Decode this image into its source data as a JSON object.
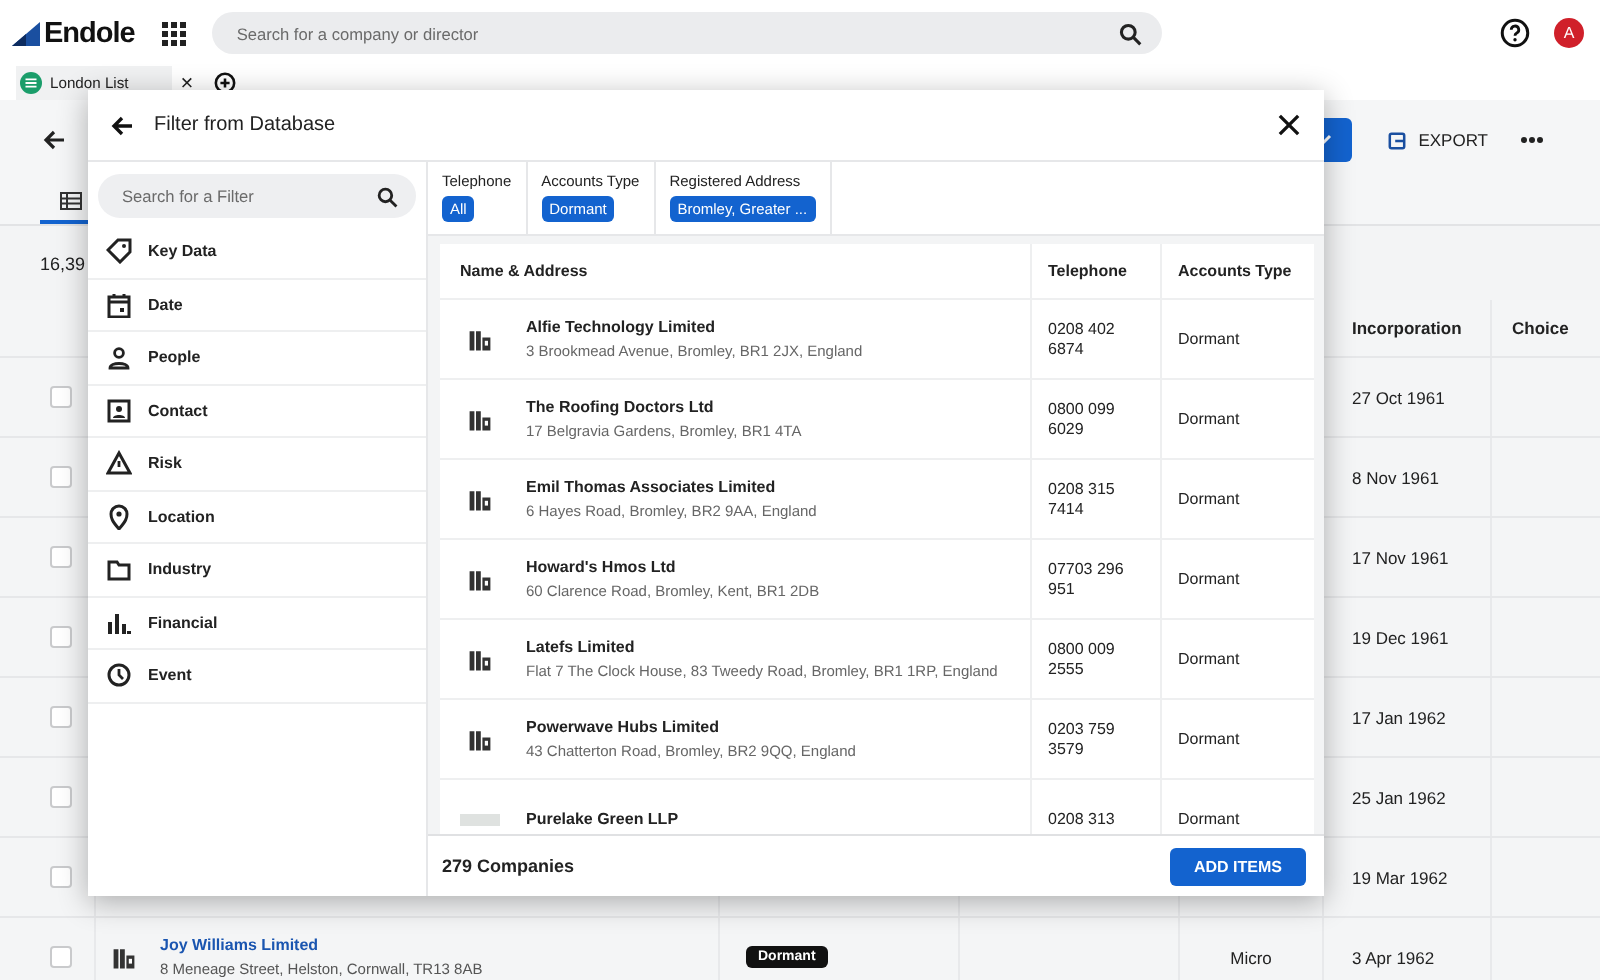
{
  "top_bar": {
    "logo": "Endole",
    "search": {
      "placeholder": "Search for a company or director"
    },
    "avatar": "A"
  },
  "tabs": [
    {
      "label": "London List",
      "selected": true,
      "close": "×"
    }
  ],
  "toolbar": {
    "export": "EXPORT"
  },
  "view_tabs": [
    {
      "selected": true
    }
  ],
  "result_count": "16,39",
  "table": {
    "columns": [
      "Incorporation",
      "Choice"
    ],
    "rows": [
      {
        "checked": false,
        "incorporation": "27 Oct 1961"
      },
      {
        "checked": false,
        "incorporation": "8 Nov 1961"
      },
      {
        "checked": false,
        "incorporation": "17 Nov 1961"
      },
      {
        "checked": false,
        "incorporation": "19 Dec 1961"
      },
      {
        "checked": false,
        "incorporation": "17 Jan 1962"
      },
      {
        "checked": false,
        "incorporation": "25 Jan 1962"
      },
      {
        "checked": false,
        "incorporation": "19 Mar 1962"
      },
      {
        "checked": false,
        "name": "Joy Williams Limited",
        "address": "8 Meneage Street, Helston, Cornwall, TR13 8AB",
        "status": "Dormant",
        "size": "Micro",
        "incorporation": "3 Apr 1962"
      }
    ]
  },
  "dialog": {
    "title": "Filter from Database",
    "search": {
      "placeholder": "Search for a Filter"
    },
    "categories": [
      "Key Data",
      "Date",
      "People",
      "Contact",
      "Risk",
      "Location",
      "Industry",
      "Financial",
      "Event"
    ],
    "active_filters": [
      {
        "label": "Telephone",
        "value": "All"
      },
      {
        "label": "Accounts Type",
        "value": "Dormant"
      },
      {
        "label": "Registered Address",
        "value": "Bromley, Greater ..."
      }
    ],
    "results": {
      "columns": [
        "Name & Address",
        "Telephone",
        "Accounts Type"
      ],
      "rows": [
        {
          "kind": "building",
          "name": "Alfie Technology Limited",
          "address": "3 Brookmead Avenue, Bromley, BR1 2JX, England",
          "telephone": "0208 402 6874",
          "accounts_type": "Dormant"
        },
        {
          "kind": "building",
          "name": "The Roofing Doctors Ltd",
          "address": "17 Belgravia Gardens, Bromley, BR1 4TA",
          "telephone": "0800 099 6029",
          "accounts_type": "Dormant"
        },
        {
          "kind": "building",
          "name": "Emil Thomas Associates Limited",
          "address": "6 Hayes Road, Bromley, BR2 9AA, England",
          "telephone": "0208 315 7414",
          "accounts_type": "Dormant"
        },
        {
          "kind": "building",
          "name": "Howard's Hmos Ltd",
          "address": "60 Clarence Road, Bromley, Kent, BR1 2DB",
          "telephone": "07703 296 951",
          "accounts_type": "Dormant"
        },
        {
          "kind": "building",
          "name": "Latefs Limited",
          "address": "Flat 7 The Clock House, 83 Tweedy Road, Bromley, BR1 1RP, England",
          "telephone": "0800 009 2555",
          "accounts_type": "Dormant"
        },
        {
          "kind": "building",
          "name": "Powerwave Hubs Limited",
          "address": "43 Chatterton Road, Bromley, BR2 9QQ, England",
          "telephone": "0203 759 3579",
          "accounts_type": "Dormant"
        },
        {
          "kind": "logo",
          "name": "Purelake Green LLP",
          "telephone": "0208 313",
          "accounts_type": "Dormant"
        }
      ]
    },
    "count": "279 Companies",
    "add_button": "ADD ITEMS"
  }
}
